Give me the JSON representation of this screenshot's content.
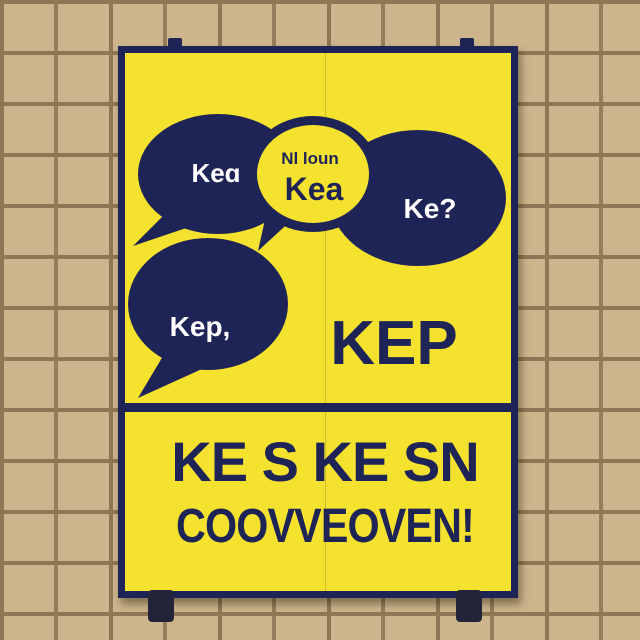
{
  "sign": {
    "bubble_1": "Keɑ",
    "bubble_2_small": "Nl loun",
    "bubble_2": "Kea",
    "bubble_3": "Ke?",
    "bubble_4": "Kep,",
    "headline": "KEP",
    "bottom_line_1": "KE S KE SN",
    "bottom_line_2": "COOVVEOVEN!"
  },
  "colors": {
    "sign_yellow": "#f4e22f",
    "ink_navy": "#1f2457",
    "brick": "#cdb48c"
  }
}
